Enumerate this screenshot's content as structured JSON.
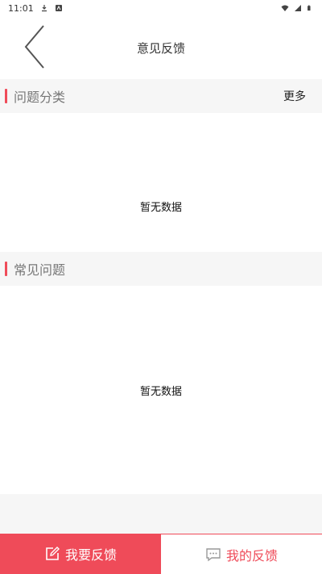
{
  "status_bar": {
    "time": "11:01",
    "icons": [
      "download-icon",
      "notification-icon",
      "wifi-icon",
      "signal-icon",
      "battery-icon"
    ]
  },
  "nav": {
    "title": "意见反馈",
    "back_icon": "chevron-left-icon"
  },
  "sections": [
    {
      "title": "问题分类",
      "more_label": "更多",
      "empty_text": "暂无数据"
    },
    {
      "title": "常见问题",
      "empty_text": "暂无数据"
    }
  ],
  "bottom_tabs": [
    {
      "label": "我要反馈",
      "icon": "edit-icon"
    },
    {
      "label": "我的反馈",
      "icon": "message-icon"
    }
  ],
  "colors": {
    "accent": "#ef4b59",
    "section_bg": "#f6f6f6"
  }
}
